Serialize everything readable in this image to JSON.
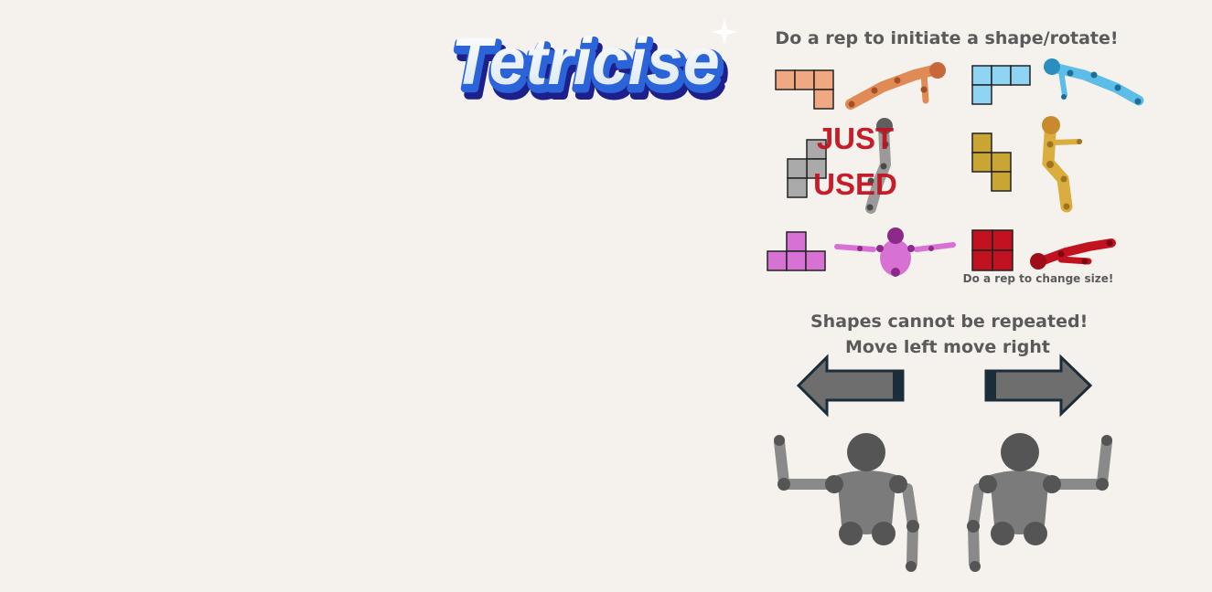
{
  "game": {
    "title": "Tetricise"
  },
  "instructions": {
    "initiate": "Do a rep to initiate a shape/rotate!",
    "change_size": "Do a rep to change size!",
    "no_repeat": "Shapes cannot be repeated!",
    "move": "Move left move right"
  },
  "shapes": [
    {
      "name": "L-piece",
      "exercise_icon": "plank-figure-icon",
      "color": "#f0a882",
      "figure_color": "#e08a55"
    },
    {
      "name": "J-piece",
      "exercise_icon": "superman-figure-icon",
      "color": "#8fd4f2",
      "figure_color": "#5bbde8"
    },
    {
      "name": "S-piece",
      "exercise_icon": "squat-side-figure-icon",
      "color": "#aaaaaa",
      "figure_color": "#9a9a9a",
      "status": "JUST USED"
    },
    {
      "name": "Z-piece",
      "exercise_icon": "squat-figure-icon",
      "color": "#c9a634",
      "figure_color": "#d9ae3e"
    },
    {
      "name": "T-piece",
      "exercise_icon": "arms-out-figure-icon",
      "color": "#d772d4",
      "figure_color": "#d772d4"
    },
    {
      "name": "O-piece",
      "exercise_icon": "lying-figure-icon",
      "color": "#c3121f",
      "figure_color": "#c3121f"
    }
  ],
  "status_overlay": {
    "line1": "JUST",
    "line2": "USED"
  },
  "controls": {
    "left_arrow_icon": "arrow-left-icon",
    "right_arrow_icon": "arrow-right-icon",
    "arrow_color": "#6e6e6e",
    "arrow_border": "#1c2d3a"
  },
  "colors": {
    "background": "#f5f2ee",
    "instruction_text": "#5a5a5a",
    "just_used_text": "#c3121f"
  }
}
